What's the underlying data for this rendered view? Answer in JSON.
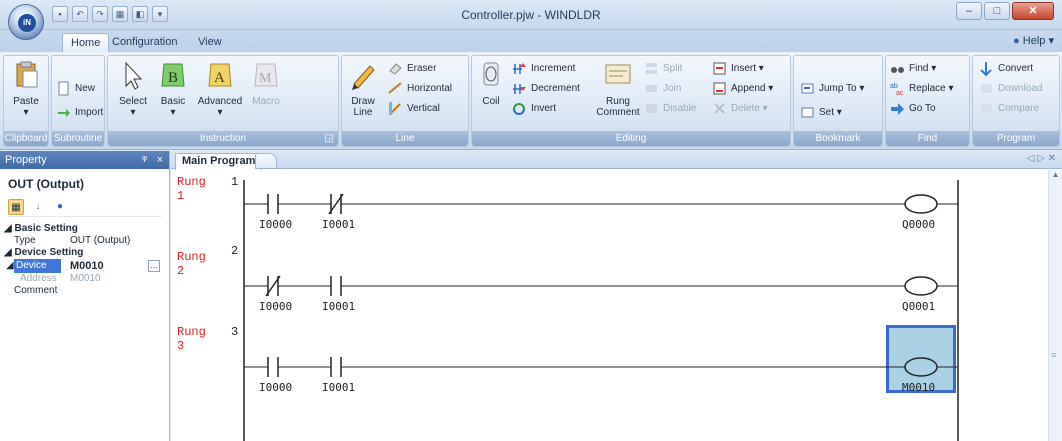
{
  "window": {
    "title": "Controller.pjw - WINDLDR",
    "logo_text": "iN"
  },
  "quick_access": [
    "save-icon",
    "undo-icon",
    "redo-icon",
    "monitor-icon",
    "dropdown-icon"
  ],
  "tabs": [
    {
      "label": "Home",
      "active": true
    },
    {
      "label": "Configuration"
    },
    {
      "label": "View"
    }
  ],
  "help_label": "Help",
  "ribbon": {
    "clipboard": {
      "title": "Clipboard",
      "paste": "Paste"
    },
    "subroutine": {
      "title": "Subroutine",
      "new": "New",
      "import": "Import"
    },
    "instruction": {
      "title": "Instruction",
      "select": "Select",
      "basic": "Basic",
      "advanced": "Advanced",
      "macro": "Macro"
    },
    "line": {
      "title": "Line",
      "draw": "Draw",
      "draw2": "Line",
      "eraser": "Eraser",
      "horizontal": "Horizontal",
      "vertical": "Vertical"
    },
    "editing": {
      "title": "Editing",
      "coil": "Coil",
      "increment": "Increment",
      "decrement": "Decrement",
      "invert": "Invert",
      "rung_comment1": "Rung",
      "rung_comment2": "Comment",
      "split": "Split",
      "join": "Join",
      "disable": "Disable",
      "insert": "Insert",
      "append": "Append",
      "delete": "Delete"
    },
    "bookmark": {
      "title": "Bookmark",
      "jump_to": "Jump To",
      "set": "Set"
    },
    "find": {
      "title": "Find",
      "find": "Find",
      "replace": "Replace",
      "goto": "Go To"
    },
    "program": {
      "title": "Program",
      "convert": "Convert",
      "download": "Download",
      "compare": "Compare"
    }
  },
  "property": {
    "header": "Property",
    "pin": "ᵠ",
    "close": "×",
    "selection": "OUT (Output)",
    "basic_setting": "Basic Setting",
    "type_key": "Type",
    "type_val": "OUT (Output)",
    "device_setting": "Device Setting",
    "device_key": "Device",
    "device_val": "M0010",
    "address_key": "Address",
    "address_val": "M0010",
    "comment_key": "Comment"
  },
  "document": {
    "tab": "Main Program",
    "rung_word": "Rung",
    "rungs": [
      {
        "n": "1",
        "contacts": [
          "I0000",
          "I0001"
        ],
        "types": [
          "NO",
          "NC"
        ],
        "coil": "Q0000",
        "selected": false
      },
      {
        "n": "2",
        "contacts": [
          "I0000",
          "I0001"
        ],
        "types": [
          "NC",
          "NO"
        ],
        "coil": "Q0001",
        "selected": false
      },
      {
        "n": "3",
        "contacts": [
          "I0000",
          "I0001"
        ],
        "types": [
          "NO",
          "NO"
        ],
        "coil": "M0010",
        "selected": true
      }
    ]
  }
}
